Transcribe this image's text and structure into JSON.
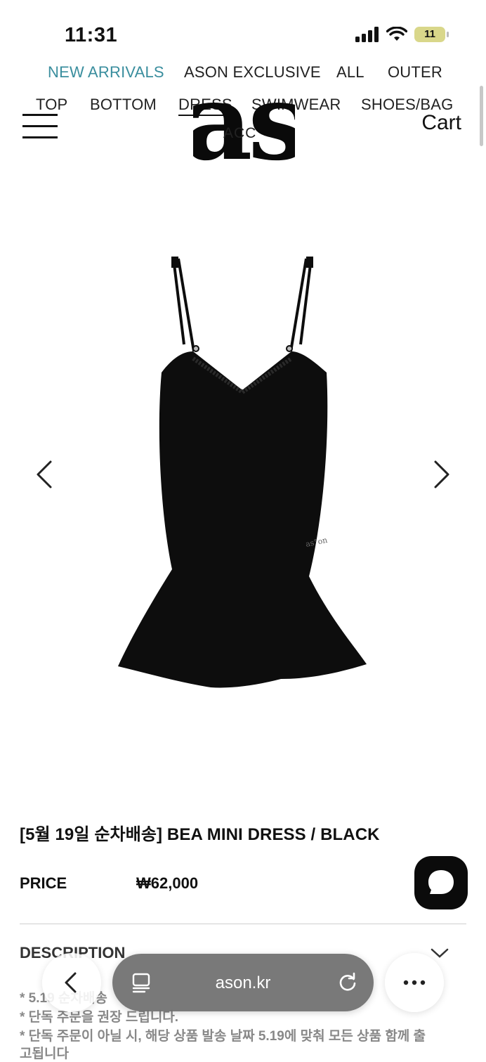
{
  "status_bar": {
    "time": "11:31",
    "battery": "11"
  },
  "nav": {
    "row1": [
      "NEW ARRIVALS",
      "ASON EXCLUSIVE",
      "ALL",
      "OUTER"
    ],
    "row2": [
      "TOP",
      "BOTTOM",
      "DRESS",
      "SWIMWEAR",
      "SHOES/BAG"
    ],
    "active": "NEW ARRIVALS",
    "selected": "DRESS"
  },
  "header": {
    "logo_text": "as",
    "logo_sub": "ACC",
    "cart_label": "Cart"
  },
  "product": {
    "watermark": "as°on",
    "title": "[5월 19일 순차배송] BEA MINI DRESS / BLACK",
    "price_label": "PRICE",
    "price_value": "₩62,000",
    "description_label": "DESCRIPTION",
    "notes": [
      "* 5.19 순차배송",
      "* 단독 주문을 권장 드립니다.",
      "* 단독 주문이 아닐 시, 해당 상품 발송 날짜 5.19에 맞춰 모든 상품 함께 출",
      "고됩니다"
    ]
  },
  "browser": {
    "url": "ason.kr"
  },
  "colors": {
    "accent": "#3a8e9e",
    "url_bar": "#6e6e6e",
    "dress": "#0d0d0d"
  },
  "icons": [
    "menu-icon",
    "chevron-left-icon",
    "chevron-right-icon",
    "chevron-down-icon",
    "chat-icon",
    "reader-icon",
    "reload-icon",
    "more-icon",
    "signal-icon",
    "wifi-icon",
    "battery-icon"
  ]
}
